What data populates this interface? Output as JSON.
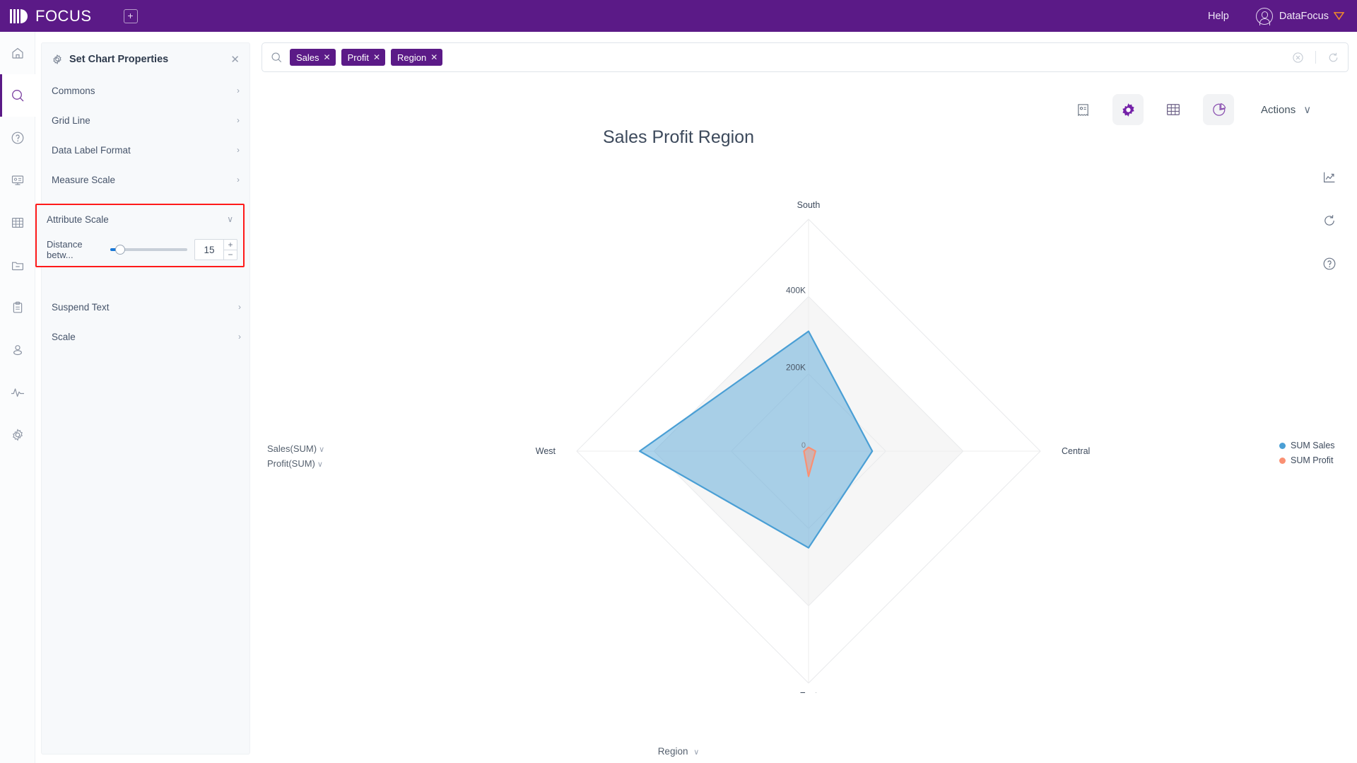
{
  "topbar": {
    "brand": "FOCUS",
    "new_tab_icon": "plus-square-icon",
    "help_label": "Help",
    "user_name": "DataFocus"
  },
  "rail": {
    "items": [
      {
        "icon": "home-icon",
        "name": "home"
      },
      {
        "icon": "search-icon",
        "name": "search",
        "active": true
      },
      {
        "icon": "question-circle-icon",
        "name": "help"
      },
      {
        "icon": "presentation-icon",
        "name": "dashboard"
      },
      {
        "icon": "table-grid-icon",
        "name": "table"
      },
      {
        "icon": "folder-minus-icon",
        "name": "folder"
      },
      {
        "icon": "clipboard-icon",
        "name": "clipboard"
      },
      {
        "icon": "user-icon",
        "name": "user"
      },
      {
        "icon": "pulse-icon",
        "name": "monitor"
      },
      {
        "icon": "gear-icon",
        "name": "settings"
      }
    ]
  },
  "panel": {
    "title": "Set Chart Properties",
    "gear_icon": "gear-icon",
    "close_icon": "close-icon",
    "rows": [
      {
        "label": "Commons",
        "chev": "›"
      },
      {
        "label": "Grid Line",
        "chev": "›"
      },
      {
        "label": "Data Label Format",
        "chev": "›"
      },
      {
        "label": "Measure Scale",
        "chev": "›"
      }
    ],
    "attribute_scale": {
      "label": "Attribute Scale",
      "chev": "∨",
      "slider_label": "Distance betw...",
      "value": "15",
      "plus": "+",
      "minus": "−",
      "highlight_color": "#ff1a1a"
    },
    "rows_after": [
      {
        "label": "Suspend Text",
        "chev": "›"
      },
      {
        "label": "Scale",
        "chev": "›"
      }
    ]
  },
  "search": {
    "icon": "search-icon",
    "chips": [
      {
        "label": "Sales",
        "close": "✕"
      },
      {
        "label": "Profit",
        "close": "✕"
      },
      {
        "label": "Region",
        "close": "✕"
      }
    ],
    "clear_icon": "clear-circle-icon",
    "refresh_icon": "refresh-icon"
  },
  "chart_toolbar": {
    "buttons": [
      {
        "icon": "receipt-icon",
        "name": "answer-detail",
        "active": false
      },
      {
        "icon": "gear-icon",
        "name": "chart-settings",
        "active": true
      },
      {
        "icon": "table-grid-icon",
        "name": "table-view",
        "active": false
      },
      {
        "icon": "pie-chart-icon",
        "name": "chart-type",
        "active": true
      }
    ],
    "actions_label": "Actions",
    "actions_chev": "∨"
  },
  "right_icons": [
    {
      "icon": "trend-chart-icon",
      "name": "trend"
    },
    {
      "icon": "refresh-icon",
      "name": "reload"
    },
    {
      "icon": "question-circle-icon",
      "name": "help"
    }
  ],
  "measure_selector": {
    "lines": [
      "Sales(SUM)",
      "Profit(SUM)"
    ],
    "chev": "∨"
  },
  "attribute_selector": {
    "label": "Region",
    "chev": "∨"
  },
  "chart_data": {
    "type": "radar",
    "title": "Sales Profit Region",
    "categories": [
      "South",
      "Central",
      "East",
      "West"
    ],
    "tick_labels": [
      "0",
      "200K",
      "400K"
    ],
    "rmax": 600000,
    "ticks": [
      0,
      200000,
      400000,
      600000
    ],
    "series": [
      {
        "name": "SUM Sales",
        "color": "#4a9fd5",
        "fill": "#4a9fd5",
        "values": [
          310000,
          165000,
          250000,
          437000
        ]
      },
      {
        "name": "SUM Profit",
        "color": "#fa9073",
        "fill": "#fa9073",
        "values": [
          10000,
          18000,
          65000,
          12000
        ]
      }
    ],
    "legend": {
      "position": "right",
      "entries": [
        "SUM Sales",
        "SUM Profit"
      ]
    },
    "grid": true,
    "xlabel": "Region",
    "ylabel": ""
  }
}
